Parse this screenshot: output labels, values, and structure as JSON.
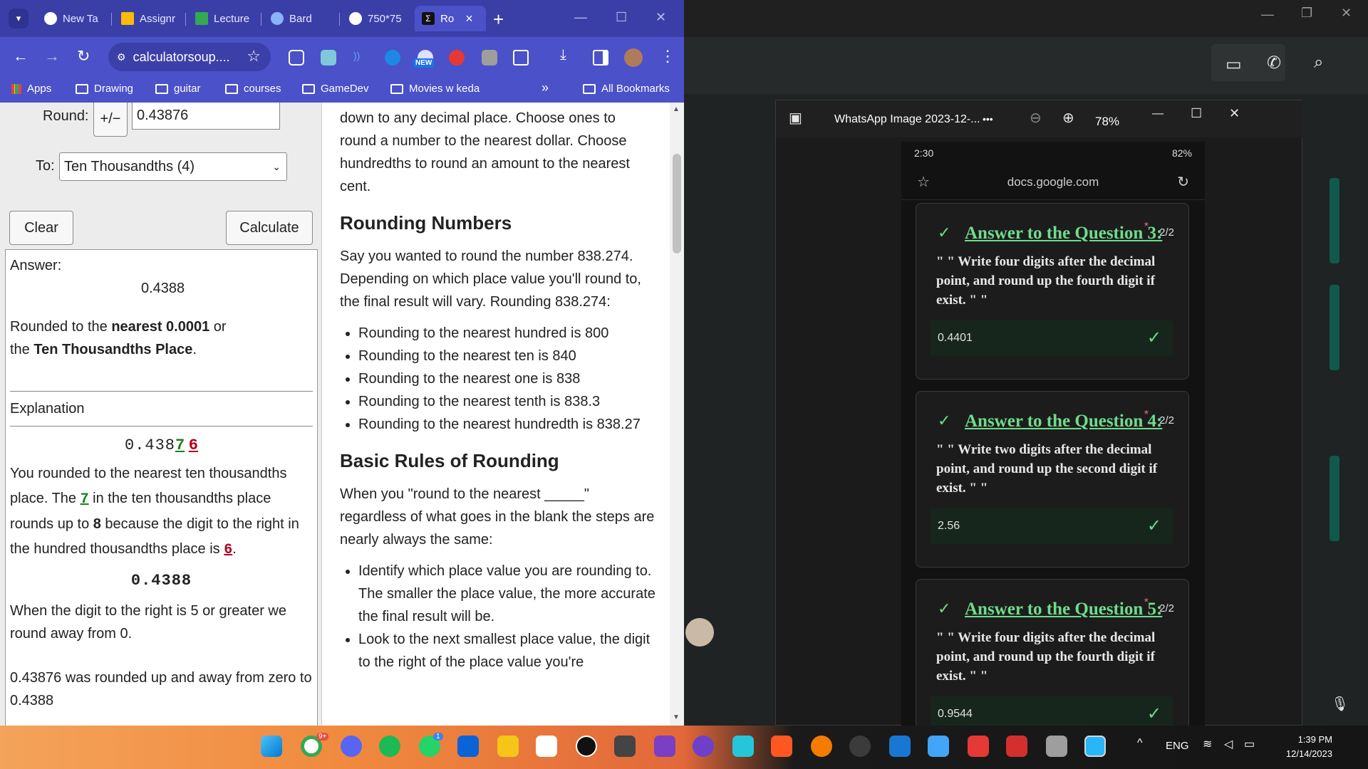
{
  "browser": {
    "tabs": [
      {
        "label": "New Ta",
        "color": "#ffffff"
      },
      {
        "label": "Assignr",
        "color": "#fbbc05"
      },
      {
        "label": "Lecture",
        "color": "#34a853"
      },
      {
        "label": "Bard",
        "color": "#8ab4f8"
      },
      {
        "label": "750*75",
        "color": "#ffffff"
      },
      {
        "label": "Ro",
        "color": "#222222",
        "close": "×"
      }
    ],
    "url": "calculatorsoup....",
    "new_badge": "NEW",
    "bookmarks": [
      "Apps",
      "Drawing",
      "guitar",
      "courses",
      "GameDev",
      "Movies w keda",
      "»",
      "All Bookmarks"
    ]
  },
  "calculator": {
    "round_label": "Round:",
    "sign_button": "+/−",
    "round_value": "0.43876",
    "to_label": "To:",
    "to_value": "Ten Thousandths (4)",
    "clear": "Clear",
    "calculate": "Calculate",
    "answer_label": "Answer:",
    "answer_value": "0.4388",
    "rounded_pre": "Rounded to the ",
    "rounded_bold": "nearest 0.0001",
    "rounded_mid": " or",
    "rounded_the": "the ",
    "rounded_place": "Ten Thousandths Place",
    "rounded_dot": ".",
    "explanation_label": "Explanation",
    "digits_prefix": "0.438",
    "digit_green": "7",
    "digit_red": "6",
    "exp1_a": "You rounded to the nearest ten thousandths place. The ",
    "exp1_b": " in the ten thousandths place rounds up to ",
    "exp1_c": "8",
    "exp1_d": " because the digit to the right in the hundred thousandths place is ",
    "exp1_e": ".",
    "result": "0.4388",
    "exp2": "When the digit to the right is 5 or greater we round away from 0.",
    "exp3": "0.43876 was rounded up and away from zero to 0.4388"
  },
  "article": {
    "intro": "down to any decimal place. Choose ones to round a number to the nearest dollar. Choose hundredths to round an amount to the nearest cent.",
    "h1": "Rounding Numbers",
    "p1": "Say you wanted to round the number 838.274. Depending on which place value you'll round to, the final result will vary. Rounding 838.274:",
    "list1": [
      "Rounding to the nearest hundred is 800",
      "Rounding to the nearest ten is 840",
      "Rounding to the nearest one is 838",
      "Rounding to the nearest tenth is 838.3",
      "Rounding to the nearest hundredth is 838.27"
    ],
    "h2": "Basic Rules of Rounding",
    "p2": "When you \"round to the nearest _____\" regardless of what goes in the blank the steps are nearly always the same:",
    "list2": [
      "Identify which place value you are rounding to. The smaller the place value, the more accurate the final result will be.",
      "Look to the next smallest place value, the digit to the right of the place value you're"
    ]
  },
  "viewer": {
    "title": "WhatsApp Image 2023-12-...",
    "more": "•••",
    "zoom": "78%",
    "phone_time": "2:30",
    "phone_battery": "82%",
    "phone_url": "docs.google.com",
    "cards": [
      {
        "title": "Answer to the Question 3",
        "colon": ":",
        "star": "*",
        "score": "2/2",
        "body": "\" \" Write four digits after the decimal point, and round up the fourth digit if exist. \" \"",
        "answer": "0.4401"
      },
      {
        "title": "Answer to the Question 4",
        "colon": ":",
        "star": "*",
        "score": "2/2",
        "body": "\" \" Write two digits after the decimal point, and round up the second digit if exist. \" \"",
        "answer": "2.56"
      },
      {
        "title": "Answer to the Question 5",
        "colon": ":",
        "star": "*",
        "score": "2/2",
        "body": "\" \" Write four digits after the decimal point, and round up the fourth digit if exist. \" \"",
        "answer": "0.9544"
      }
    ]
  },
  "taskbar": {
    "lang": "ENG",
    "time": "1:39 PM",
    "date": "12/14/2023",
    "chrome_badge": "9+",
    "whatsapp_badge": "1"
  }
}
